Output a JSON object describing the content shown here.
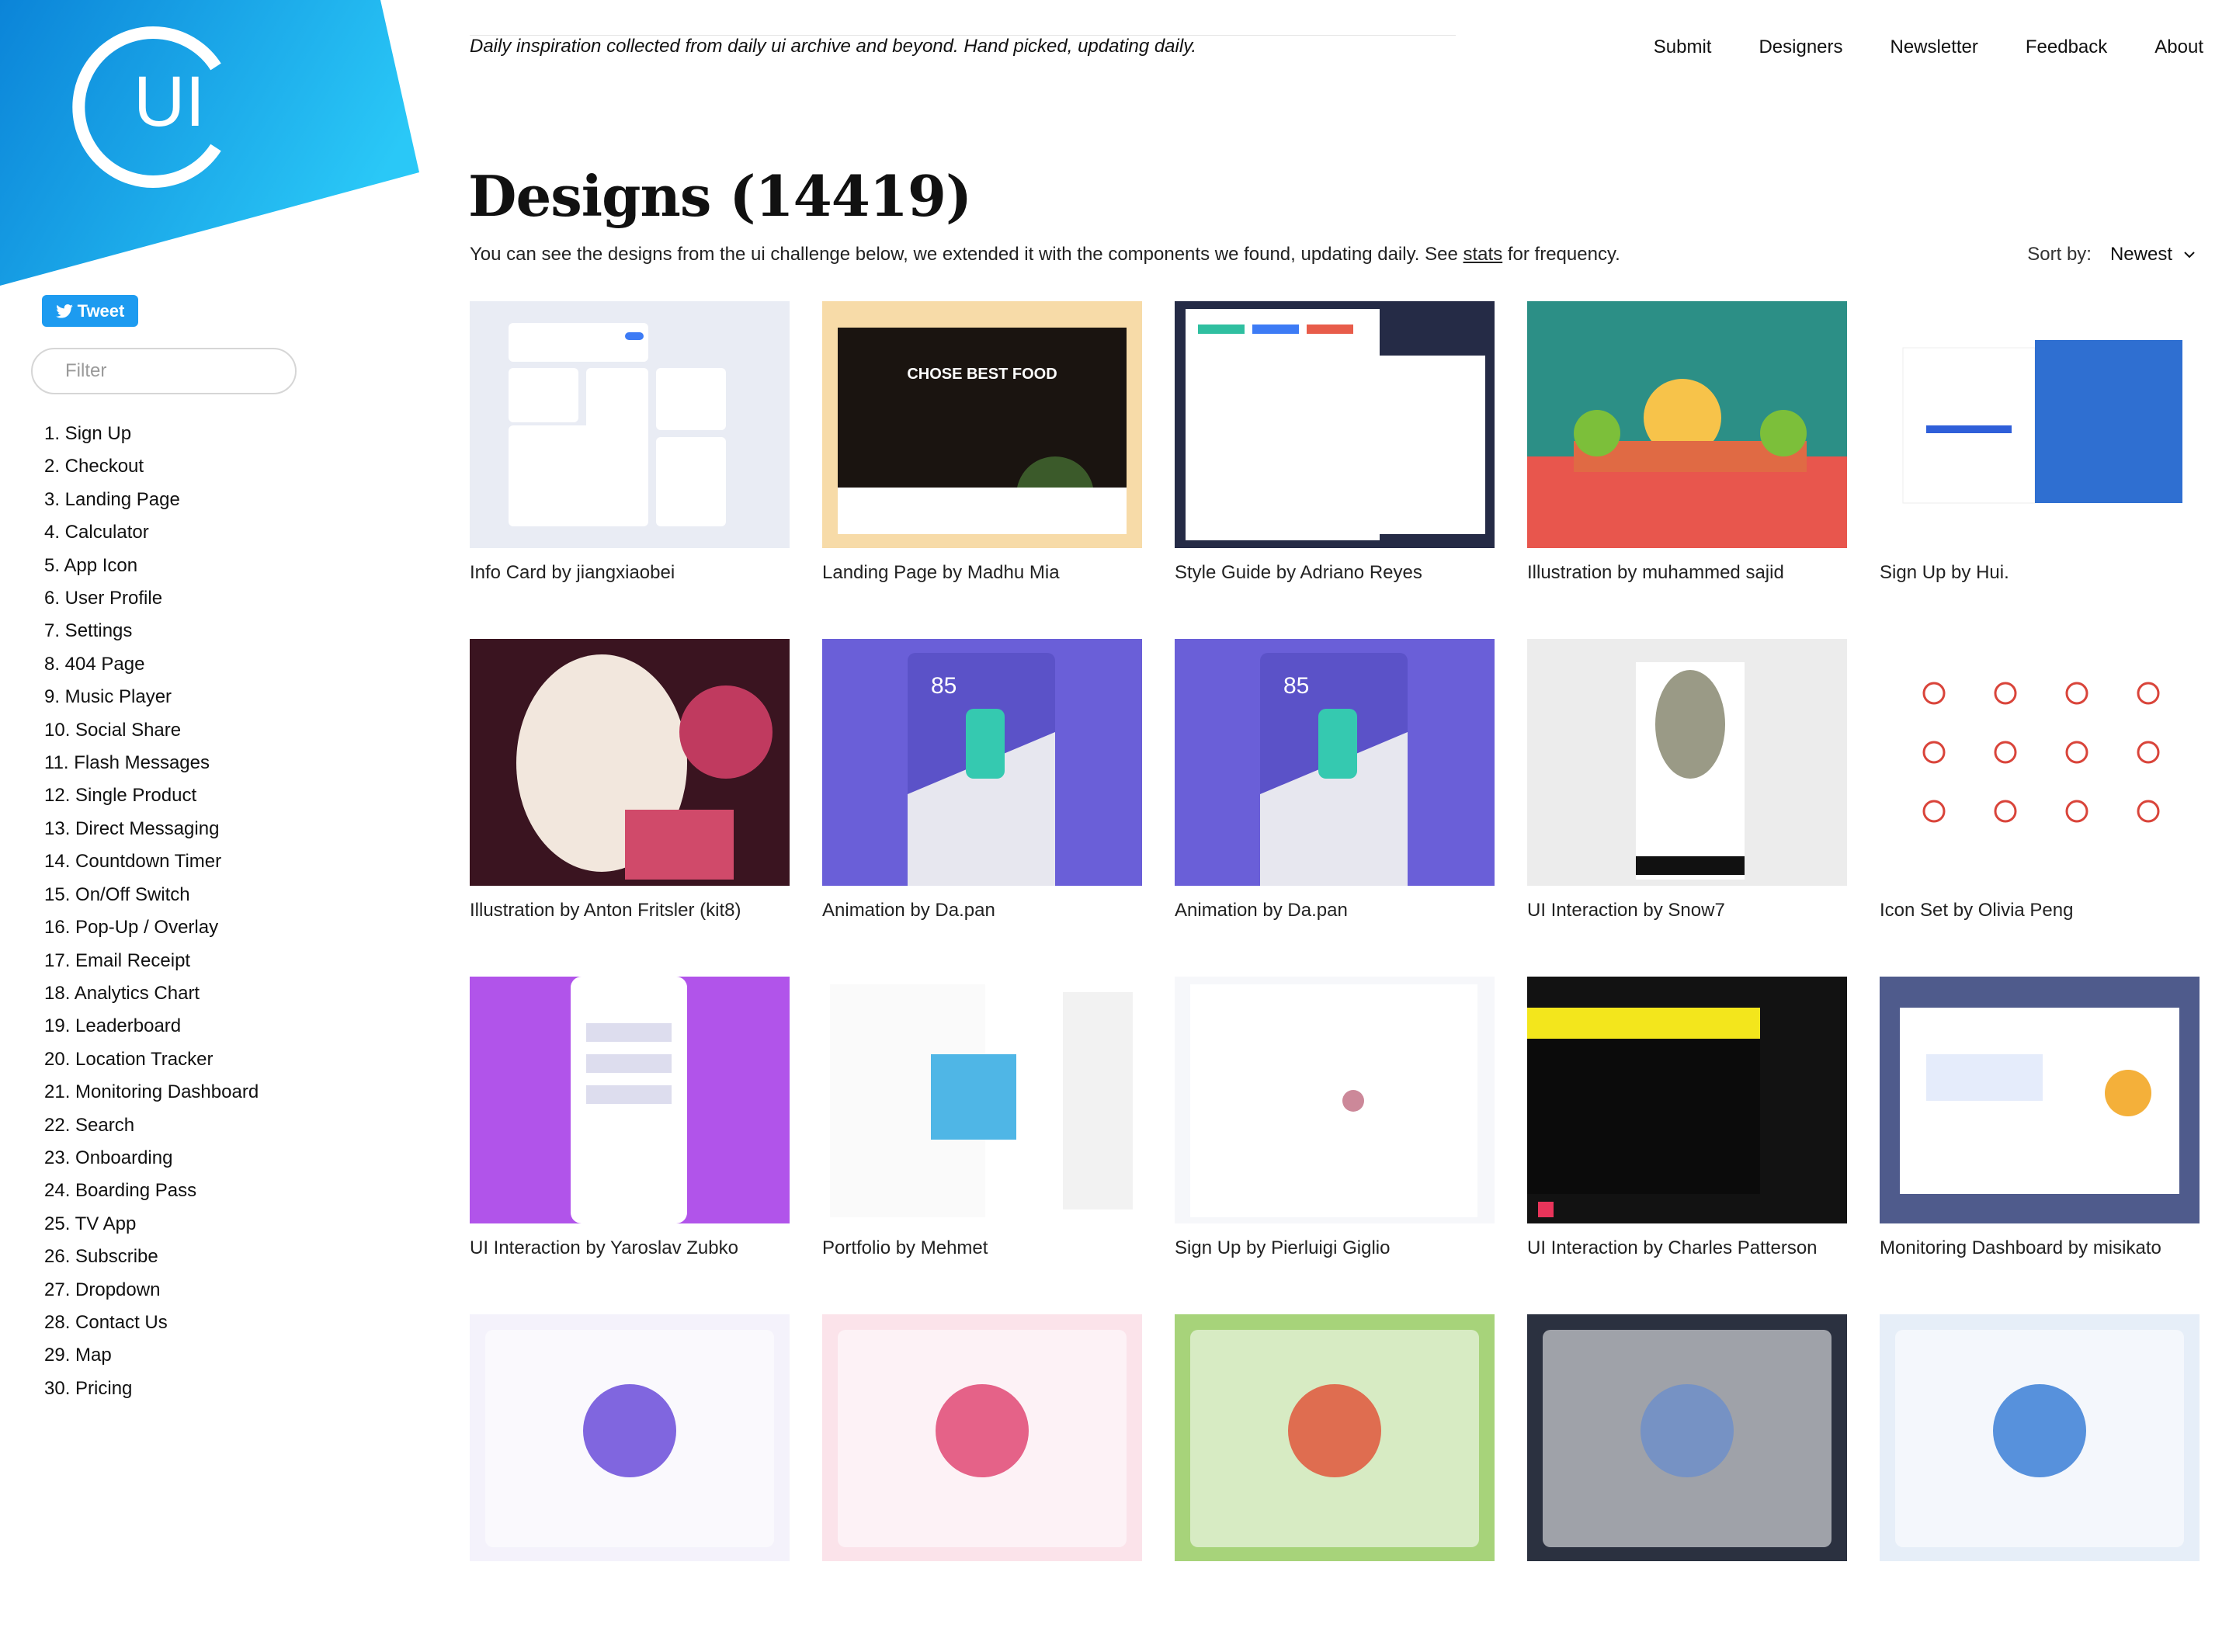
{
  "header": {
    "logo_text": "UI",
    "tagline": "Daily inspiration collected from daily ui archive and beyond. Hand picked, updating daily.",
    "nav": [
      "Submit",
      "Designers",
      "Newsletter",
      "Feedback",
      "About"
    ]
  },
  "sidebar": {
    "tweet_label": "Tweet",
    "filter_placeholder": "Filter",
    "items": [
      "1. Sign Up",
      "2. Checkout",
      "3. Landing Page",
      "4. Calculator",
      "5. App Icon",
      "6. User Profile",
      "7. Settings",
      "8. 404 Page",
      "9. Music Player",
      "10. Social Share",
      "11. Flash Messages",
      "12. Single Product",
      "13. Direct Messaging",
      "14. Countdown Timer",
      "15. On/Off Switch",
      "16. Pop-Up / Overlay",
      "17. Email Receipt",
      "18. Analytics Chart",
      "19. Leaderboard",
      "20. Location Tracker",
      "21. Monitoring Dashboard",
      "22. Search",
      "23. Onboarding",
      "24. Boarding Pass",
      "25. TV App",
      "26. Subscribe",
      "27. Dropdown",
      "28. Contact Us",
      "29. Map",
      "30. Pricing"
    ]
  },
  "main": {
    "title": "Designs (14419)",
    "subtitle_before": "You can see the designs from the ui challenge below, we extended it with the components we found, updating daily. See ",
    "subtitle_link": "stats",
    "subtitle_after": " for frequency.",
    "sort_label": "Sort by:",
    "sort_value": "Newest",
    "cards": [
      {
        "caption": "Info Card by jiangxiaobei",
        "bg": "#e9ecf4",
        "accent": "#3d7bf5"
      },
      {
        "caption": "Landing Page by Madhu Mia",
        "bg": "#f7dba8",
        "accent": "#1a1410"
      },
      {
        "caption": "Style Guide by Adriano Reyes",
        "bg": "#252b46",
        "accent": "#2fbfa0"
      },
      {
        "caption": "Illustration by muhammed sajid",
        "bg": "#2c8f86",
        "accent": "#e8564d"
      },
      {
        "caption": "Sign Up by Hui.",
        "bg": "#ffffff",
        "accent": "#2f5fd9"
      },
      {
        "caption": "Illustration by Anton Fritsler (kit8)",
        "bg": "#3a1420",
        "accent": "#c03a5f"
      },
      {
        "caption": "Animation by Da.pan",
        "bg": "#6a5fd8",
        "accent": "#35c9b0"
      },
      {
        "caption": "Animation by Da.pan",
        "bg": "#6a5fd8",
        "accent": "#35c9b0"
      },
      {
        "caption": "UI Interaction by Snow7",
        "bg": "#ececec",
        "accent": "#9a9a86"
      },
      {
        "caption": "Icon Set by Olivia Peng",
        "bg": "#ffffff",
        "accent": "#d9443a"
      },
      {
        "caption": "UI Interaction by Yaroslav Zubko",
        "bg": "#b154ea",
        "accent": "#ffffff"
      },
      {
        "caption": "Portfolio by Mehmet",
        "bg": "#ffffff",
        "accent": "#2a9fd6"
      },
      {
        "caption": "Sign Up by Pierluigi Giglio",
        "bg": "#f6f7fa",
        "accent": "#3577e0"
      },
      {
        "caption": "UI Interaction by Charles Patterson",
        "bg": "#121212",
        "accent": "#f3e61c"
      },
      {
        "caption": "Monitoring Dashboard by misikato",
        "bg": "#4f5b8c",
        "accent": "#ffffff"
      },
      {
        "caption": "",
        "bg": "#f4f2fb",
        "accent": "#6a4cd9"
      },
      {
        "caption": "",
        "bg": "#fbe3ea",
        "accent": "#e04974"
      },
      {
        "caption": "",
        "bg": "#a7d37a",
        "accent": "#e0573c"
      },
      {
        "caption": "",
        "bg": "#2b3140",
        "accent": "#6f8fc9"
      },
      {
        "caption": "",
        "bg": "#e6eef8",
        "accent": "#3b7fd6"
      }
    ]
  },
  "colors": {
    "logo_blue": "#1aa0e6",
    "tweet_blue": "#1d9bf0"
  }
}
